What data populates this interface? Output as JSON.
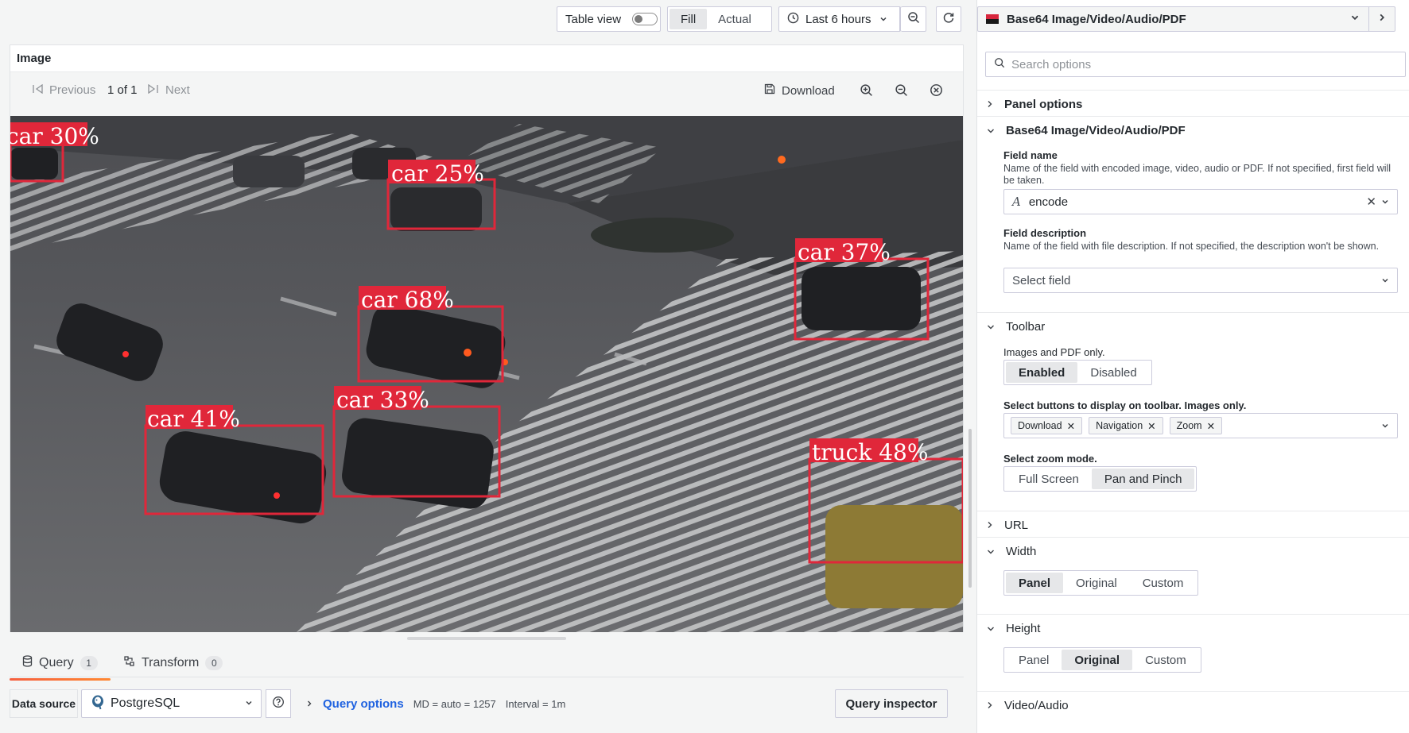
{
  "toolbar": {
    "table_view_label": "Table view",
    "fill_label": "Fill",
    "actual_label": "Actual",
    "time_range": "Last 6 hours",
    "icons": [
      "clock-icon",
      "chevron-down-icon",
      "zoom-out-icon",
      "refresh-icon"
    ]
  },
  "panel": {
    "title": "Image",
    "previous_label": "Previous",
    "page_indicator": "1 of 1",
    "next_label": "Next",
    "download_label": "Download",
    "detections": [
      {
        "label": "car 30%"
      },
      {
        "label": "car 25%"
      },
      {
        "label": "car 37%"
      },
      {
        "label": "car 68%"
      },
      {
        "label": "car 41%"
      },
      {
        "label": "car 33%"
      },
      {
        "label": "truck 48%"
      }
    ],
    "box_color": "#e0273a"
  },
  "query": {
    "tab_query": "Query",
    "tab_query_count": "1",
    "tab_transform": "Transform",
    "tab_transform_count": "0",
    "data_source_label": "Data source",
    "data_source_value": "PostgreSQL",
    "query_options_label": "Query options",
    "md_text": "MD = auto = 1257",
    "interval_text": "Interval = 1m",
    "inspector_label": "Query inspector"
  },
  "sidebar": {
    "viz_name": "Base64 Image/Video/Audio/PDF",
    "search_placeholder": "Search options",
    "panel_options_label": "Panel options",
    "plugin_section_label": "Base64 Image/Video/Audio/PDF",
    "field_name_label": "Field name",
    "field_name_desc": "Name of the field with encoded image, video, audio or PDF. If not specified, first field will be taken.",
    "field_name_value": "encode",
    "field_desc_label": "Field description",
    "field_desc_desc": "Name of the field with file description. If not specified, the description won't be shown.",
    "field_desc_placeholder": "Select field",
    "toolbar_section_label": "Toolbar",
    "images_pdf_only_label": "Images and PDF only.",
    "toolbar_enabled": "Enabled",
    "toolbar_disabled": "Disabled",
    "select_buttons_label": "Select buttons to display on toolbar. Images only.",
    "button_tags": [
      "Download",
      "Navigation",
      "Zoom"
    ],
    "zoom_mode_label": "Select zoom mode.",
    "zoom_full_screen": "Full Screen",
    "zoom_pan_pinch": "Pan and Pinch",
    "url_section_label": "URL",
    "width_section_label": "Width",
    "width_options": [
      "Panel",
      "Original",
      "Custom"
    ],
    "height_section_label": "Height",
    "height_options": [
      "Panel",
      "Original",
      "Custom"
    ],
    "video_audio_section_label": "Video/Audio"
  }
}
